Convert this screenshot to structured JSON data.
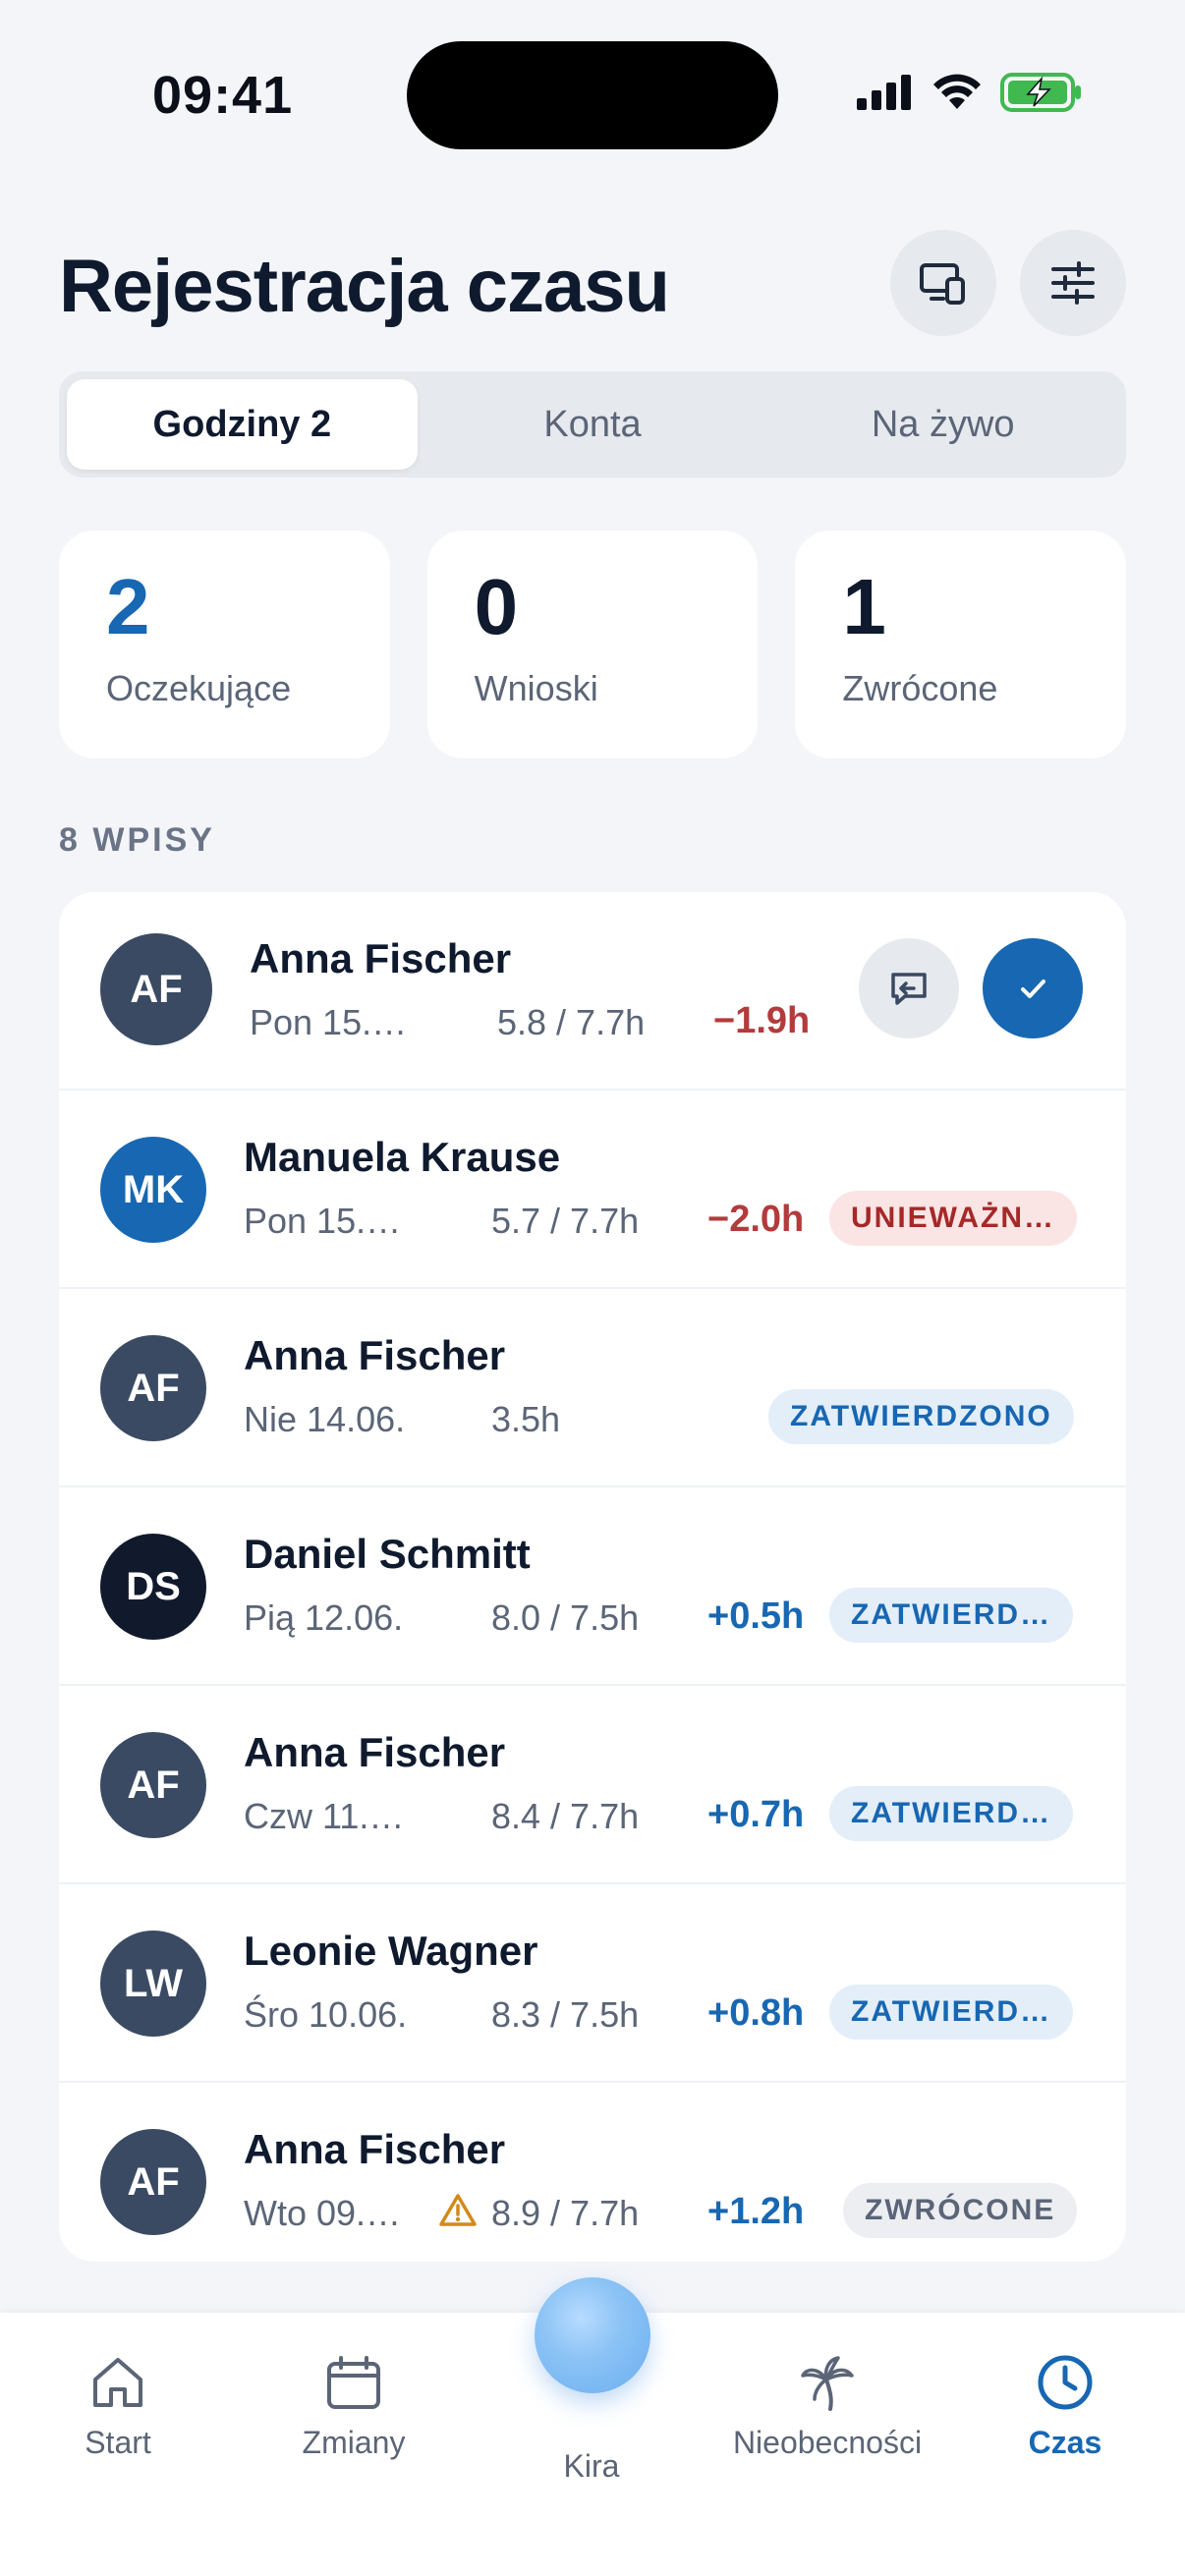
{
  "status_bar": {
    "time": "09:41"
  },
  "header": {
    "title": "Rejestracja czasu"
  },
  "segments": [
    {
      "label": "Godziny 2",
      "active": true
    },
    {
      "label": "Konta",
      "active": false
    },
    {
      "label": "Na żywo",
      "active": false
    }
  ],
  "stats": [
    {
      "value": "2",
      "label": "Oczekujące",
      "color": "#1767b2"
    },
    {
      "value": "0",
      "label": "Wnioski",
      "color": "#0f1a2e"
    },
    {
      "value": "1",
      "label": "Zwrócone",
      "color": "#0f1a2e"
    }
  ],
  "section_label": "8 WPISY",
  "entries": [
    {
      "initials": "AF",
      "avatar_color": "#3a4a63",
      "name": "Anna Fischer",
      "date": "Pon 15.…",
      "hours": "5.8 / 7.7h",
      "diff": "−1.9h",
      "diff_type": "neg",
      "badge": "",
      "actions": true
    },
    {
      "initials": "MK",
      "avatar_color": "#1767b2",
      "name": "Manuela Krause",
      "date": "Pon 15.…",
      "hours": "5.7 / 7.7h",
      "diff": "−2.0h",
      "diff_type": "neg",
      "badge": "UNIEWAŻN…",
      "badge_type": "red"
    },
    {
      "initials": "AF",
      "avatar_color": "#3a4a63",
      "name": "Anna Fischer",
      "date": "Nie 14.06.",
      "hours": "3.5h",
      "diff": "",
      "diff_type": "",
      "badge": "ZATWIERDZONO",
      "badge_type": "blue"
    },
    {
      "initials": "DS",
      "avatar_color": "#111a2c",
      "name": "Daniel Schmitt",
      "date": "Pią 12.06.",
      "hours": "8.0 / 7.5h",
      "diff": "+0.5h",
      "diff_type": "pos",
      "badge": "ZATWIERD…",
      "badge_type": "blue"
    },
    {
      "initials": "AF",
      "avatar_color": "#3a4a63",
      "name": "Anna Fischer",
      "date": "Czw 11.…",
      "hours": "8.4 / 7.7h",
      "diff": "+0.7h",
      "diff_type": "pos",
      "badge": "ZATWIERD…",
      "badge_type": "blue"
    },
    {
      "initials": "LW",
      "avatar_color": "#3a4a63",
      "name": "Leonie Wagner",
      "date": "Śro 10.06.",
      "hours": "8.3 / 7.5h",
      "diff": "+0.8h",
      "diff_type": "pos",
      "badge": "ZATWIERD…",
      "badge_type": "blue"
    },
    {
      "initials": "AF",
      "avatar_color": "#3a4a63",
      "name": "Anna Fischer",
      "date": "Wto 09.…",
      "hours": "8.9 / 7.7h",
      "diff": "+1.2h",
      "diff_type": "pos",
      "badge": "ZWRÓCONE",
      "badge_type": "gray",
      "warning": true
    }
  ],
  "tabbar": [
    {
      "label": "Start",
      "icon": "home-icon",
      "active": false
    },
    {
      "label": "Zmiany",
      "icon": "calendar-icon",
      "active": false
    },
    {
      "label": "Kira",
      "icon": "kira-orb",
      "active": false
    },
    {
      "label": "Nieobecności",
      "icon": "palm-tree-icon",
      "active": false
    },
    {
      "label": "Czas",
      "icon": "clock-icon",
      "active": true
    }
  ],
  "colors": {
    "accent": "#1767b2",
    "negative": "#b33b3b",
    "background": "#f3f5f9"
  }
}
